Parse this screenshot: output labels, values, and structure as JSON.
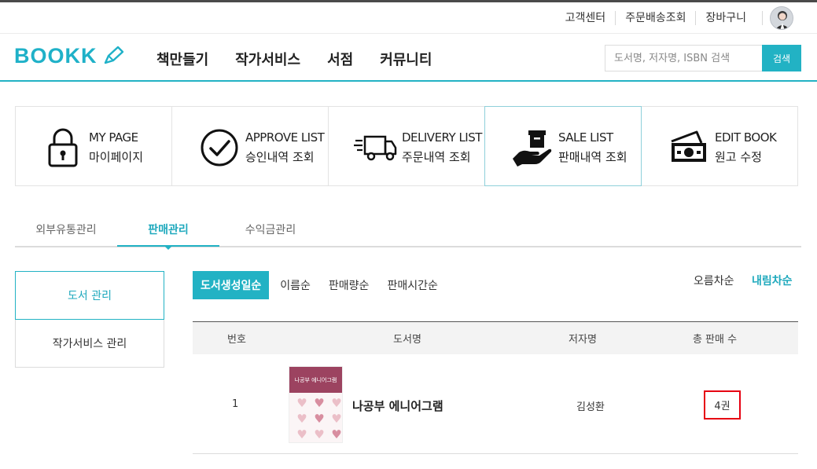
{
  "util": {
    "links": [
      "고객센터",
      "주문배송조회",
      "장바구니"
    ]
  },
  "header": {
    "logo": "BOOKK",
    "nav": [
      "책만들기",
      "작가서비스",
      "서점",
      "커뮤니티"
    ],
    "search_placeholder": "도서명, 저자명, ISBN 검색",
    "search_button": "검색"
  },
  "menu_boxes": [
    {
      "en": "MY PAGE",
      "ko": "마이페이지",
      "icon": "lock-icon"
    },
    {
      "en": "APPROVE LIST",
      "ko": "승인내역 조회",
      "icon": "check-circle-icon"
    },
    {
      "en": "DELIVERY LIST",
      "ko": "주문내역 조회",
      "icon": "delivery-truck-icon"
    },
    {
      "en": "SALE LIST",
      "ko": "판매내역 조회",
      "icon": "hand-box-icon",
      "active": true
    },
    {
      "en": "EDIT BOOK",
      "ko": "원고 수정",
      "icon": "money-icon"
    }
  ],
  "tabs": [
    "외부유통관리",
    "판매관리",
    "수익금관리"
  ],
  "active_tab": "판매관리",
  "side_nav": [
    "도서 관리",
    "작가서비스 관리"
  ],
  "sort": {
    "options": [
      "도서생성일순",
      "이름순",
      "판매량순",
      "판매시간순"
    ],
    "active": "도서생성일순",
    "order_asc": "오름차순",
    "order_desc": "내림차순"
  },
  "table": {
    "headers": [
      "번호",
      "도서명",
      "저자명",
      "총 판매 수"
    ],
    "rows": [
      {
        "no": "1",
        "title": "나공부 에니어그램",
        "author": "김성환",
        "sales": "4권"
      }
    ]
  },
  "cover": {
    "title": "나공부 에니어그램"
  },
  "colors": {
    "accent": "#22b2c4",
    "highlight": "#e60012"
  }
}
